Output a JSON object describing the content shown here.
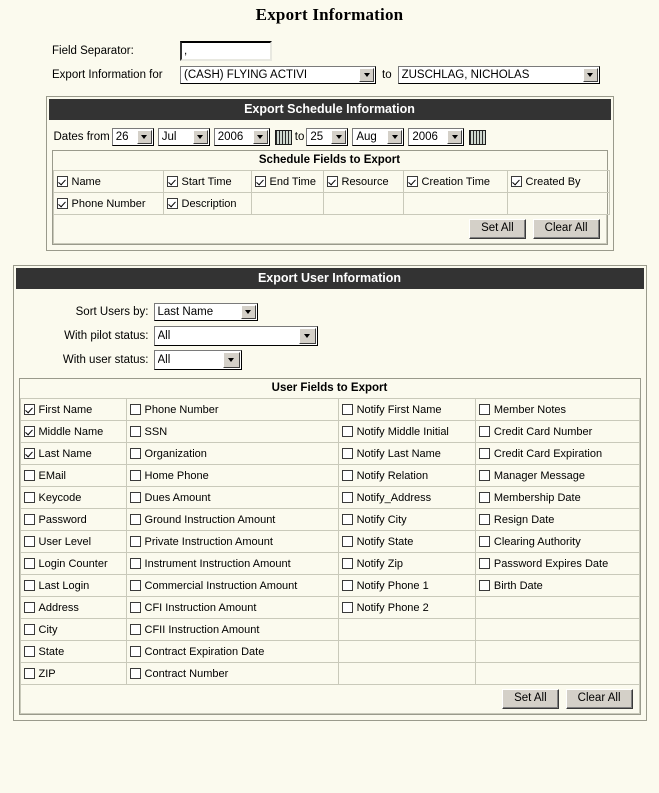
{
  "page": {
    "title": "Export Information",
    "colors": {
      "header_bar": "#333333",
      "background": "#fbfaee",
      "button_face": "#d4d0c8"
    }
  },
  "top_form": {
    "field_separator_label": "Field Separator:",
    "field_separator_value": ",",
    "export_info_label": "Export Information for",
    "export_from_value": "(CASH) FLYING ACTIVI",
    "to_word": "to",
    "export_to_value": "ZUSCHLAG, NICHOLAS"
  },
  "schedule": {
    "header": "Export Schedule Information",
    "dates_label": "Dates from",
    "to_label": "to",
    "from": {
      "day": "26",
      "month": "Jul",
      "year": "2006"
    },
    "until": {
      "day": "25",
      "month": "Aug",
      "year": "2006"
    },
    "calendar_icon_name": "calendar-icon",
    "fields_title": "Schedule Fields to Export",
    "fields_rows": [
      [
        {
          "label": "Name",
          "checked": true
        },
        {
          "label": "Start Time",
          "checked": true
        },
        {
          "label": "End Time",
          "checked": true
        },
        {
          "label": "Resource",
          "checked": true
        },
        {
          "label": "Creation Time",
          "checked": true
        },
        {
          "label": "Created By",
          "checked": true
        }
      ],
      [
        {
          "label": "Phone Number",
          "checked": true
        },
        {
          "label": "Description",
          "checked": true
        },
        {
          "label": "",
          "checked": null
        },
        {
          "label": "",
          "checked": null
        },
        {
          "label": "",
          "checked": null
        },
        {
          "label": "",
          "checked": null
        }
      ]
    ],
    "set_all_label": "Set All",
    "clear_all_label": "Clear All"
  },
  "user": {
    "header": "Export User Information",
    "sort_label": "Sort Users by:",
    "sort_value": "Last Name",
    "pilot_label": "With pilot status:",
    "pilot_value": "All",
    "user_status_label": "With user status:",
    "user_status_value": "All",
    "fields_title": "User Fields to Export",
    "fields_rows": [
      [
        {
          "label": "First Name",
          "checked": true
        },
        {
          "label": "Phone Number",
          "checked": false
        },
        {
          "label": "Notify First Name",
          "checked": false
        },
        {
          "label": "Member Notes",
          "checked": false
        }
      ],
      [
        {
          "label": "Middle Name",
          "checked": true
        },
        {
          "label": "SSN",
          "checked": false
        },
        {
          "label": "Notify Middle Initial",
          "checked": false
        },
        {
          "label": "Credit Card Number",
          "checked": false
        }
      ],
      [
        {
          "label": "Last Name",
          "checked": true
        },
        {
          "label": "Organization",
          "checked": false
        },
        {
          "label": "Notify Last Name",
          "checked": false
        },
        {
          "label": "Credit Card Expiration",
          "checked": false
        }
      ],
      [
        {
          "label": "EMail",
          "checked": false
        },
        {
          "label": "Home Phone",
          "checked": false
        },
        {
          "label": "Notify Relation",
          "checked": false
        },
        {
          "label": "Manager Message",
          "checked": false
        }
      ],
      [
        {
          "label": "Keycode",
          "checked": false
        },
        {
          "label": "Dues Amount",
          "checked": false
        },
        {
          "label": "Notify_Address",
          "checked": false
        },
        {
          "label": "Membership Date",
          "checked": false
        }
      ],
      [
        {
          "label": "Password",
          "checked": false
        },
        {
          "label": "Ground Instruction Amount",
          "checked": false
        },
        {
          "label": "Notify City",
          "checked": false
        },
        {
          "label": "Resign Date",
          "checked": false
        }
      ],
      [
        {
          "label": "User Level",
          "checked": false
        },
        {
          "label": "Private Instruction Amount",
          "checked": false
        },
        {
          "label": "Notify State",
          "checked": false
        },
        {
          "label": "Clearing Authority",
          "checked": false
        }
      ],
      [
        {
          "label": "Login Counter",
          "checked": false
        },
        {
          "label": "Instrument Instruction Amount",
          "checked": false
        },
        {
          "label": "Notify Zip",
          "checked": false
        },
        {
          "label": "Password Expires Date",
          "checked": false
        }
      ],
      [
        {
          "label": "Last Login",
          "checked": false
        },
        {
          "label": "Commercial Instruction Amount",
          "checked": false
        },
        {
          "label": "Notify Phone 1",
          "checked": false
        },
        {
          "label": "Birth Date",
          "checked": false
        }
      ],
      [
        {
          "label": "Address",
          "checked": false
        },
        {
          "label": "CFI Instruction Amount",
          "checked": false
        },
        {
          "label": "Notify Phone 2",
          "checked": false
        },
        {
          "label": "",
          "checked": null
        }
      ],
      [
        {
          "label": "City",
          "checked": false
        },
        {
          "label": "CFII Instruction Amount",
          "checked": false
        },
        {
          "label": "",
          "checked": null
        },
        {
          "label": "",
          "checked": null
        }
      ],
      [
        {
          "label": "State",
          "checked": false
        },
        {
          "label": "Contract Expiration Date",
          "checked": false
        },
        {
          "label": "",
          "checked": null
        },
        {
          "label": "",
          "checked": null
        }
      ],
      [
        {
          "label": "ZIP",
          "checked": false
        },
        {
          "label": "Contract Number",
          "checked": false
        },
        {
          "label": "",
          "checked": null
        },
        {
          "label": "",
          "checked": null
        }
      ]
    ],
    "set_all_label": "Set All",
    "clear_all_label": "Clear All"
  }
}
